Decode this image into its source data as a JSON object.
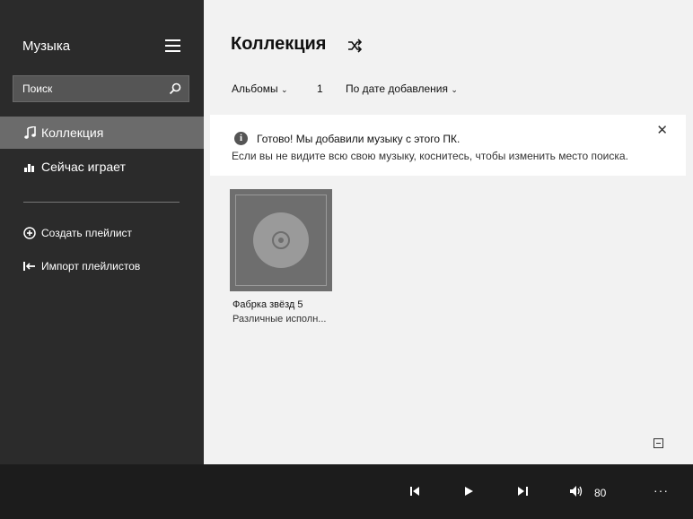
{
  "app": {
    "title": "Музыка"
  },
  "search": {
    "placeholder": "Поиск"
  },
  "sidebar": {
    "nav": [
      {
        "label": "Коллекция",
        "icon": "music-note-icon",
        "active": true
      },
      {
        "label": "Сейчас играет",
        "icon": "equalizer-icon",
        "active": false
      }
    ],
    "actions": [
      {
        "label": "Создать плейлист",
        "icon": "plus-circle-icon"
      },
      {
        "label": "Импорт плейлистов",
        "icon": "import-icon"
      }
    ]
  },
  "main": {
    "title": "Коллекция",
    "filters": {
      "view": "Альбомы",
      "count": "1",
      "sort": "По дате добавления"
    },
    "notice": {
      "title": "Готово! Мы добавили музыку с этого ПК.",
      "body": "Если вы не видите всю свою музыку, коснитесь, чтобы изменить место поиска.",
      "close": "✕"
    },
    "albums": [
      {
        "title": "Фабрка звёзд 5",
        "artist": "Различные исполн..."
      }
    ]
  },
  "player": {
    "volume": "80",
    "more": "···"
  },
  "colors": {
    "sidebar": "#2b2b2b",
    "active_nav": "#6b6b6b",
    "main_bg": "#f2f2f2",
    "player_bg": "#1c1c1c"
  }
}
